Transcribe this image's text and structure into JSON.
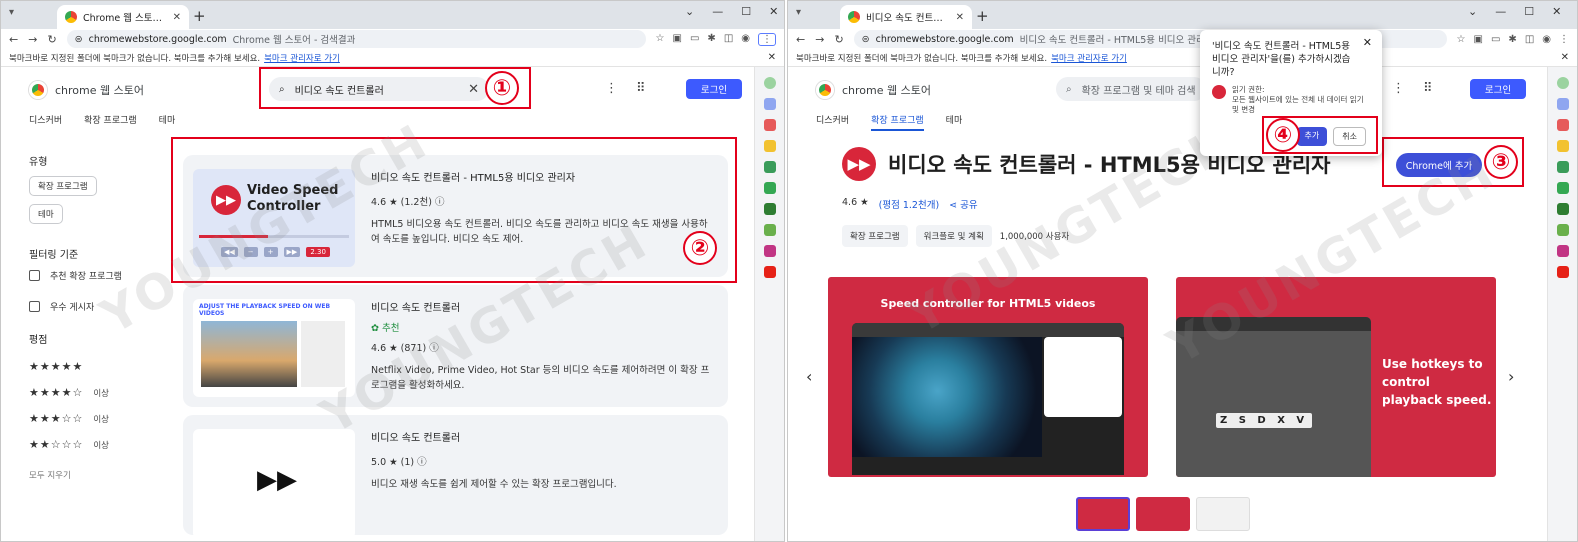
{
  "left": {
    "tab_title": "Chrome 웹 스토어 - 검색결과",
    "url_host": "chromewebstore.google.com",
    "url_title": "Chrome 웹 스토어 - 검색결과",
    "bookmark_msg": "북마크바로 지정된 폴더에 북마크가 없습니다. 북마크를 추가해 보세요.",
    "bookmark_link": "북마크 관리자로 가기",
    "logo_text": "chrome 웹 스토어",
    "search_value": "비디오 속도 컨트롤러",
    "login": "로그인",
    "nav": [
      "디스커버",
      "확장 프로그램",
      "테마"
    ],
    "filter_type_heading": "유형",
    "filter_type_chips": [
      "확장 프로그램",
      "테마"
    ],
    "filter_criteria_heading": "필터링 기준",
    "filter_checks": [
      "추천 확장 프로그램",
      "우수 게시자"
    ],
    "rating_heading": "평점",
    "rating_rows": [
      {
        "stars": "★★★★★",
        "suffix": ""
      },
      {
        "stars": "★★★★☆",
        "suffix": "이상"
      },
      {
        "stars": "★★★☆☆",
        "suffix": "이상"
      },
      {
        "stars": "★★☆☆☆",
        "suffix": "이상"
      }
    ],
    "clear_all": "모두 지우기",
    "results": [
      {
        "title": "비디오 속도 컨트롤러 - HTML5용 비디오 관리자",
        "rating": "4.6 ★ (1.2천) ⓘ",
        "desc": "HTML5 비디오용 속도 컨트롤러. 비디오 속도를 관리하고 비디오 속도 재생을 사용하여 속도를 높입니다. 비디오 속도 제어.",
        "thumb_line1": "Video Speed",
        "thumb_line2": "Controller",
        "thumb_speed": "2.30"
      },
      {
        "title": "비디오 속도 컨트롤러",
        "reco": "✿ 추천",
        "rating": "4.6 ★ (871) ⓘ",
        "desc": "Netflix Video, Prime Video, Hot Star 등의 비디오 속도를 제어하려면 이 확장 프로그램을 활성화하세요.",
        "thumb_caption": "ADJUST THE PLAYBACK SPEED ON WEB VIDEOS"
      },
      {
        "title": "비디오 속도 컨트롤러",
        "rating": "5.0 ★ (1) ⓘ",
        "desc": "비디오 재생 속도를 쉽게 제어할 수 있는 확장 프로그램입니다."
      }
    ],
    "badges": [
      "①",
      "②"
    ]
  },
  "right": {
    "tab_title": "비디오 속도 컨트롤러 - HTML",
    "url_host": "chromewebstore.google.com",
    "url_title": "비디오 속도 컨트롤러 - HTML5용 비디오 관리자 - Chrome 웹 스토어",
    "bookmark_msg": "북마크바로 지정된 폴더에 북마크가 없습니다. 북마크를 추가해 보세요.",
    "bookmark_link": "북마크 관리자로 가기",
    "logo_text": "chrome 웹 스토어",
    "search_placeholder": "확장 프로그램 및 테마 검색",
    "login": "로그인",
    "nav": [
      "디스커버",
      "확장 프로그램",
      "테마"
    ],
    "ext_title": "비디오 속도 컨트롤러 - HTML5용 비디오 관리자",
    "ext_rating": "4.6 ★",
    "ext_rating_link": "(평점 1.2천개)",
    "share": "공유",
    "tags": [
      "확장 프로그램",
      "워크플로 및 계획"
    ],
    "users": "1,000,000 사용자",
    "add_button": "Chrome에 추가",
    "shot1_caption": "Speed controller for HTML5 videos",
    "shot2_caption_1": "Use hotkeys to control",
    "shot2_caption_2": "playback speed.",
    "shot2_keys": "Z S D X V",
    "dialog_question": "'비디오 속도 컨트롤러 - HTML5용 비디오 관리자'을(를) 추가하시겠습니까?",
    "dialog_perm_title": "읽기 권한:",
    "dialog_perm_desc": "모든 웹사이트에 있는 전체 내 데이터 읽기 및 변경",
    "dialog_ok": "추가",
    "dialog_cancel": "취소",
    "badges": [
      "③",
      "④"
    ]
  },
  "watermark": "YOUNGTECH"
}
